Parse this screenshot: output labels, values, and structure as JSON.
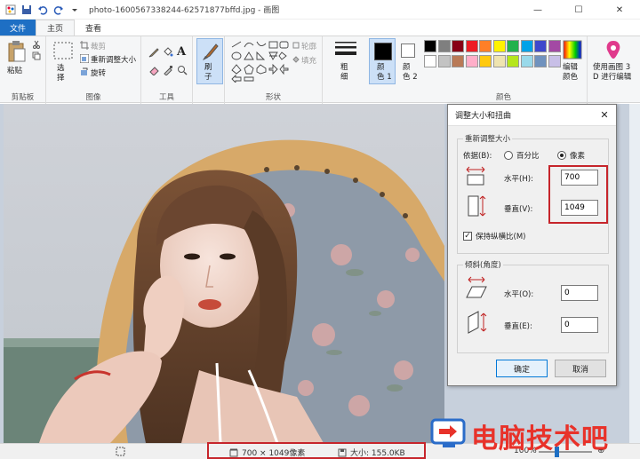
{
  "window": {
    "title": "photo-1600567338244-62571877bffd.jpg - 画图",
    "min": "—",
    "max": "☐",
    "close": "✕"
  },
  "tabs": [
    {
      "label": "文件"
    },
    {
      "label": "主页"
    },
    {
      "label": "查看"
    }
  ],
  "ribbon": {
    "clipboard": {
      "label": "剪贴板",
      "paste": "粘贴"
    },
    "image": {
      "label": "图像",
      "select": "选\n择",
      "crop": "裁剪",
      "resize": "重新调整大小",
      "rotate": "旋转"
    },
    "tools": {
      "label": "工具",
      "text_tool": "A"
    },
    "brush": {
      "label": "刷\n子"
    },
    "shapes": {
      "label": "形状",
      "outline": "轮廓",
      "fill": "填充"
    },
    "size": {
      "label": "粗\n细"
    },
    "color1": {
      "label": "颜\n色 1"
    },
    "color2": {
      "label": "颜\n色 2"
    },
    "colors": {
      "label": "颜色",
      "edit": "编辑\n颜色"
    },
    "paint3d": {
      "label": "使用画图 3\nD 进行编辑"
    },
    "palette_row1": [
      "#000000",
      "#7f7f7f",
      "#880015",
      "#ed1c24",
      "#ff7f27",
      "#fff200",
      "#22b14c",
      "#00a2e8",
      "#3f48cc",
      "#a349a4"
    ],
    "palette_row2": [
      "#ffffff",
      "#c3c3c3",
      "#b97a57",
      "#ffaec9",
      "#ffc90e",
      "#efe4b0",
      "#b5e61d",
      "#99d9ea",
      "#7092be",
      "#c8bfe7"
    ]
  },
  "dialog": {
    "title": "调整大小和扭曲",
    "close": "✕",
    "resize_section": "重新调整大小",
    "by_label": "依据(B):",
    "percent_label": "百分比",
    "pixels_label": "像素",
    "horizontal_label": "水平(H):",
    "horizontal_value": "700",
    "vertical_label": "垂直(V):",
    "vertical_value": "1049",
    "keep_aspect_label": "保持纵横比(M)",
    "skew_section": "倾斜(角度)",
    "skew_h_label": "水平(O):",
    "skew_h_value": "0",
    "skew_v_label": "垂直(E):",
    "skew_v_value": "0",
    "ok": "确定",
    "cancel": "取消"
  },
  "statusbar": {
    "dimensions": "700 × 1049像素",
    "size": "大小: 155.0KB",
    "zoom": "100%"
  },
  "watermark": {
    "text": "电脑技术吧"
  }
}
